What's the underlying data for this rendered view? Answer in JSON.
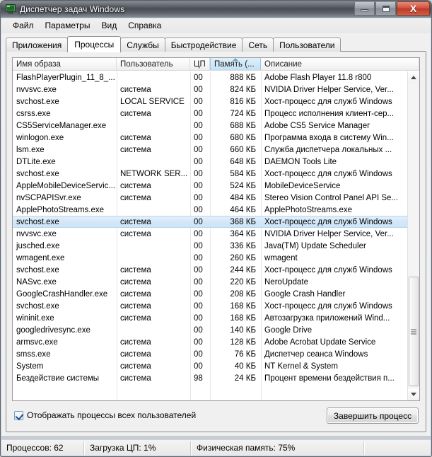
{
  "window": {
    "title": "Диспетчер задач Windows",
    "icon": "task-manager-icon",
    "minimize_label": "—",
    "maximize_label": "□",
    "close_label": "X"
  },
  "menu": {
    "items": [
      {
        "label": "Файл"
      },
      {
        "label": "Параметры"
      },
      {
        "label": "Вид"
      },
      {
        "label": "Справка"
      }
    ]
  },
  "tabs": [
    {
      "label": "Приложения",
      "active": false
    },
    {
      "label": "Процессы",
      "active": true
    },
    {
      "label": "Службы",
      "active": false
    },
    {
      "label": "Быстродействие",
      "active": false
    },
    {
      "label": "Сеть",
      "active": false
    },
    {
      "label": "Пользователи",
      "active": false
    }
  ],
  "table": {
    "columns": [
      {
        "label": "Имя образа",
        "sorted": false
      },
      {
        "label": "Пользователь",
        "sorted": false
      },
      {
        "label": "ЦП",
        "sorted": false
      },
      {
        "label": "Память (...",
        "sorted": true,
        "sort_direction": "ascending"
      },
      {
        "label": "Описание",
        "sorted": false
      }
    ],
    "rows": [
      {
        "name": "FlashPlayerPlugin_11_8_...",
        "user": "",
        "cpu": "00",
        "memory": "888 КБ",
        "description": "Adobe Flash Player 11.8 r800",
        "selected": false
      },
      {
        "name": "nvvsvc.exe",
        "user": "система",
        "cpu": "00",
        "memory": "824 КБ",
        "description": "NVIDIA Driver Helper Service, Ver...",
        "selected": false
      },
      {
        "name": "svchost.exe",
        "user": "LOCAL SERVICE",
        "cpu": "00",
        "memory": "816 КБ",
        "description": "Хост-процесс для служб Windows",
        "selected": false
      },
      {
        "name": "csrss.exe",
        "user": "система",
        "cpu": "00",
        "memory": "724 КБ",
        "description": "Процесс исполнения клиент-сер...",
        "selected": false
      },
      {
        "name": "CS5ServiceManager.exe",
        "user": "",
        "cpu": "00",
        "memory": "688 КБ",
        "description": "Adobe CS5 Service Manager",
        "selected": false
      },
      {
        "name": "winlogon.exe",
        "user": "система",
        "cpu": "00",
        "memory": "680 КБ",
        "description": "Программа входа в систему Win...",
        "selected": false
      },
      {
        "name": "lsm.exe",
        "user": "система",
        "cpu": "00",
        "memory": "660 КБ",
        "description": "Служба диспетчера локальных ...",
        "selected": false
      },
      {
        "name": "DTLite.exe",
        "user": "",
        "cpu": "00",
        "memory": "648 КБ",
        "description": "DAEMON Tools Lite",
        "selected": false
      },
      {
        "name": "svchost.exe",
        "user": "NETWORK SER...",
        "cpu": "00",
        "memory": "584 КБ",
        "description": "Хост-процесс для служб Windows",
        "selected": false
      },
      {
        "name": "AppleMobileDeviceServic...",
        "user": "система",
        "cpu": "00",
        "memory": "524 КБ",
        "description": "MobileDeviceService",
        "selected": false
      },
      {
        "name": "nvSCPAPISvr.exe",
        "user": "система",
        "cpu": "00",
        "memory": "484 КБ",
        "description": "Stereo Vision Control Panel API Se...",
        "selected": false
      },
      {
        "name": "ApplePhotoStreams.exe",
        "user": "",
        "cpu": "00",
        "memory": "464 КБ",
        "description": "ApplePhotoStreams.exe",
        "selected": false
      },
      {
        "name": "svchost.exe",
        "user": "система",
        "cpu": "00",
        "memory": "368 КБ",
        "description": "Хост-процесс для служб Windows",
        "selected": true
      },
      {
        "name": "nvvsvc.exe",
        "user": "система",
        "cpu": "00",
        "memory": "364 КБ",
        "description": "NVIDIA Driver Helper Service, Ver...",
        "selected": false
      },
      {
        "name": "jusched.exe",
        "user": "",
        "cpu": "00",
        "memory": "336 КБ",
        "description": "Java(TM) Update Scheduler",
        "selected": false
      },
      {
        "name": "wmagent.exe",
        "user": "",
        "cpu": "00",
        "memory": "260 КБ",
        "description": "wmagent",
        "selected": false
      },
      {
        "name": "svchost.exe",
        "user": "система",
        "cpu": "00",
        "memory": "244 КБ",
        "description": "Хост-процесс для служб Windows",
        "selected": false
      },
      {
        "name": "NASvc.exe",
        "user": "система",
        "cpu": "00",
        "memory": "220 КБ",
        "description": "NeroUpdate",
        "selected": false
      },
      {
        "name": "GoogleCrashHandler.exe",
        "user": "система",
        "cpu": "00",
        "memory": "208 КБ",
        "description": "Google Crash Handler",
        "selected": false
      },
      {
        "name": "svchost.exe",
        "user": "система",
        "cpu": "00",
        "memory": "168 КБ",
        "description": "Хост-процесс для служб Windows",
        "selected": false
      },
      {
        "name": "wininit.exe",
        "user": "система",
        "cpu": "00",
        "memory": "168 КБ",
        "description": "Автозагрузка приложений Wind...",
        "selected": false
      },
      {
        "name": "googledrivesync.exe",
        "user": "",
        "cpu": "00",
        "memory": "140 КБ",
        "description": "Google Drive",
        "selected": false
      },
      {
        "name": "armsvc.exe",
        "user": "система",
        "cpu": "00",
        "memory": "128 КБ",
        "description": "Adobe Acrobat Update Service",
        "selected": false
      },
      {
        "name": "smss.exe",
        "user": "система",
        "cpu": "00",
        "memory": "76 КБ",
        "description": "Диспетчер сеанса  Windows",
        "selected": false
      },
      {
        "name": "System",
        "user": "система",
        "cpu": "00",
        "memory": "40 КБ",
        "description": "NT Kernel & System",
        "selected": false
      },
      {
        "name": "Бездействие системы",
        "user": "система",
        "cpu": "98",
        "memory": "24 КБ",
        "description": "Процент времени бездействия п...",
        "selected": false
      }
    ]
  },
  "footer": {
    "show_all_users_label": "Отображать процессы всех пользователей",
    "show_all_users_checked": true,
    "end_process_label": "Завершить процесс"
  },
  "statusbar": {
    "processes": "Процессов: 62",
    "cpu_usage": "Загрузка ЦП: 1%",
    "physical_memory": "Физическая память: 75%",
    "empty": ""
  },
  "colors": {
    "selection": "#d3e7f8",
    "sorted_header": "#cfe8f7",
    "close_button": "#bc3c27",
    "checkbox_check": "#21518a"
  }
}
